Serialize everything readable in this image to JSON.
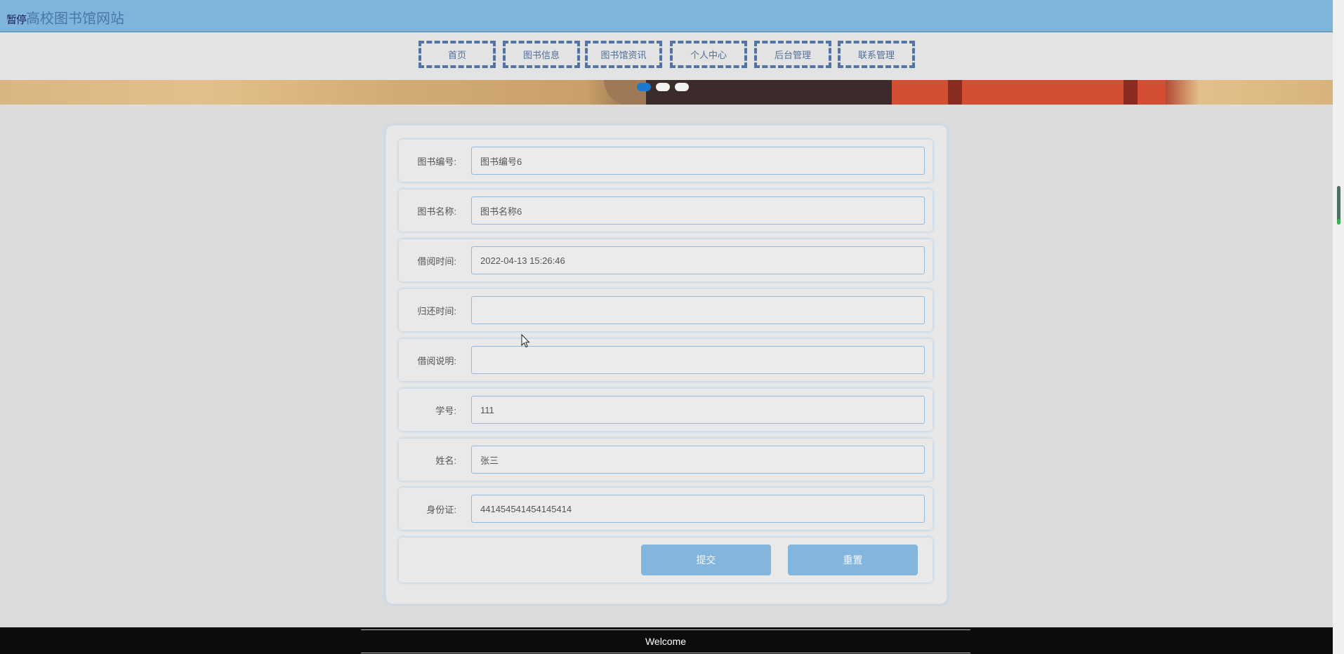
{
  "header": {
    "title_prefix": "暂停",
    "title": "高校图书馆网站"
  },
  "nav": {
    "items": [
      {
        "label": "首页"
      },
      {
        "label": "图书信息"
      },
      {
        "label": "图书馆资讯"
      },
      {
        "label": "个人中心"
      },
      {
        "label": "后台管理"
      },
      {
        "label": "联系管理"
      }
    ]
  },
  "carousel": {
    "slide_count": 3,
    "active_index": 0
  },
  "form": {
    "fields": [
      {
        "label": "图书编号:",
        "value": "图书编号6",
        "placeholder": ""
      },
      {
        "label": "图书名称:",
        "value": "图书名称6",
        "placeholder": ""
      },
      {
        "label": "借阅时间:",
        "value": "2022-04-13 15:26:46",
        "placeholder": ""
      },
      {
        "label": "归还时间:",
        "value": "",
        "placeholder": ""
      },
      {
        "label": "借阅说明:",
        "value": "",
        "placeholder": ""
      },
      {
        "label": "学号:",
        "value": "111",
        "placeholder": ""
      },
      {
        "label": "姓名:",
        "value": "张三",
        "placeholder": ""
      },
      {
        "label": "身份证:",
        "value": "441454541454145414",
        "placeholder": ""
      }
    ],
    "submit_label": "提交",
    "reset_label": "重置"
  },
  "footer": {
    "text": "Welcome"
  },
  "colors": {
    "header_bg": "#80b5db",
    "nav_border": "#5273a3",
    "button_bg": "#84b5dc",
    "active_dot": "#1a7ad1",
    "footer_bg": "#0c0c0c"
  }
}
